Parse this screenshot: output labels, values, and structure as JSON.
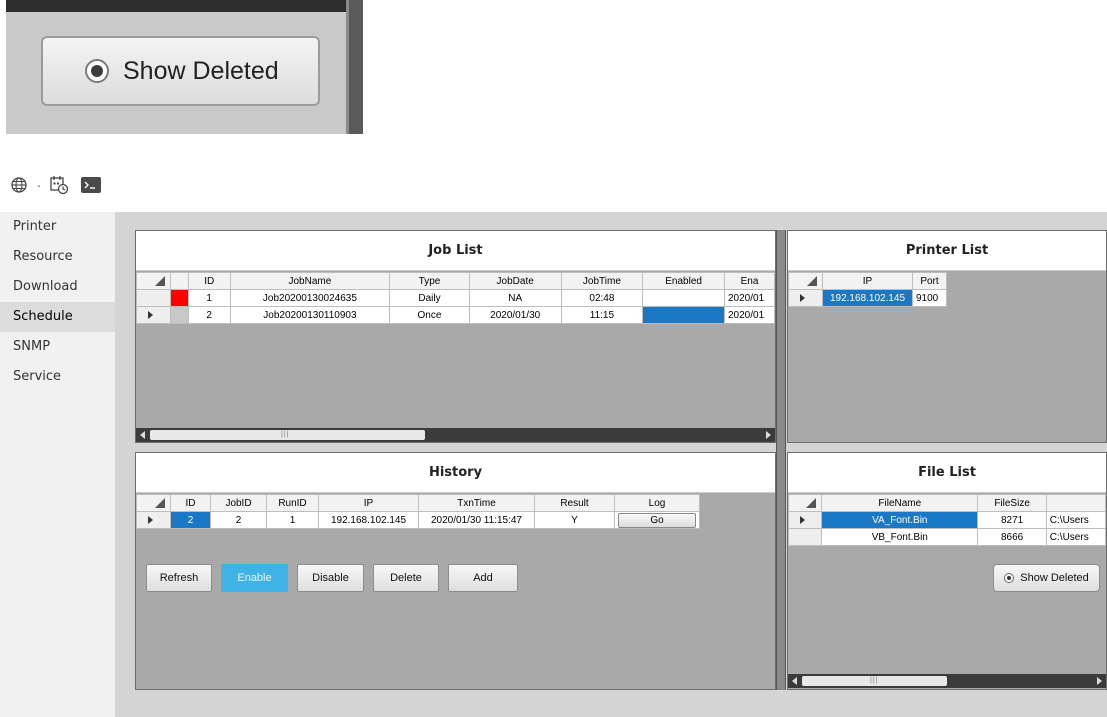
{
  "zoom_inset": {
    "label": "Show Deleted"
  },
  "sidebar": {
    "items": [
      {
        "label": "Printer"
      },
      {
        "label": "Resource"
      },
      {
        "label": "Download"
      },
      {
        "label": "Schedule"
      },
      {
        "label": "SNMP"
      },
      {
        "label": "Service"
      }
    ],
    "active": "Schedule"
  },
  "job_list": {
    "title": "Job List",
    "columns": [
      "ID",
      "JobName",
      "Type",
      "JobDate",
      "JobTime",
      "Enabled",
      "Ena"
    ],
    "rows": [
      {
        "id": "1",
        "jobname": "Job20200130024635",
        "type": "Daily",
        "jobdate": "NA",
        "jobtime": "02:48",
        "enabled": "",
        "ena": "2020/01"
      },
      {
        "id": "2",
        "jobname": "Job20200130110903",
        "type": "Once",
        "jobdate": "2020/01/30",
        "jobtime": "11:15",
        "enabled": "",
        "ena": "2020/01"
      }
    ],
    "scroll_grip": "|||"
  },
  "printer_list": {
    "title": "Printer List",
    "columns": [
      "IP",
      "Port"
    ],
    "rows": [
      {
        "ip": "192.168.102.145",
        "port": "9100"
      }
    ]
  },
  "history": {
    "title": "History",
    "columns": [
      "ID",
      "JobID",
      "RunID",
      "IP",
      "TxnTime",
      "Result",
      "Log"
    ],
    "rows": [
      {
        "id": "2",
        "jobid": "2",
        "runid": "1",
        "ip": "192.168.102.145",
        "txntime": "2020/01/30 11:15:47",
        "result": "Y",
        "log": "Go"
      }
    ]
  },
  "file_list": {
    "title": "File List",
    "columns": [
      "FileName",
      "FileSize",
      ""
    ],
    "rows": [
      {
        "filename": "VA_Font.Bin",
        "filesize": "8271",
        "path": "C:\\Users"
      },
      {
        "filename": "VB_Font.Bin",
        "filesize": "8666",
        "path": "C:\\Users"
      }
    ],
    "scroll_grip": "|||"
  },
  "buttons": {
    "refresh": "Refresh",
    "enable": "Enable",
    "disable": "Disable",
    "delete": "Delete",
    "add": "Add",
    "show_deleted": "Show Deleted"
  },
  "icons": {
    "globe": "globe-icon",
    "calendar": "calendar-clock-icon",
    "terminal": "terminal-icon"
  },
  "colors": {
    "selection_blue": "#1b78c6",
    "header_selected": "#f9c77f",
    "enable_button": "#3fb2e6",
    "status_red": "#ff0000"
  }
}
